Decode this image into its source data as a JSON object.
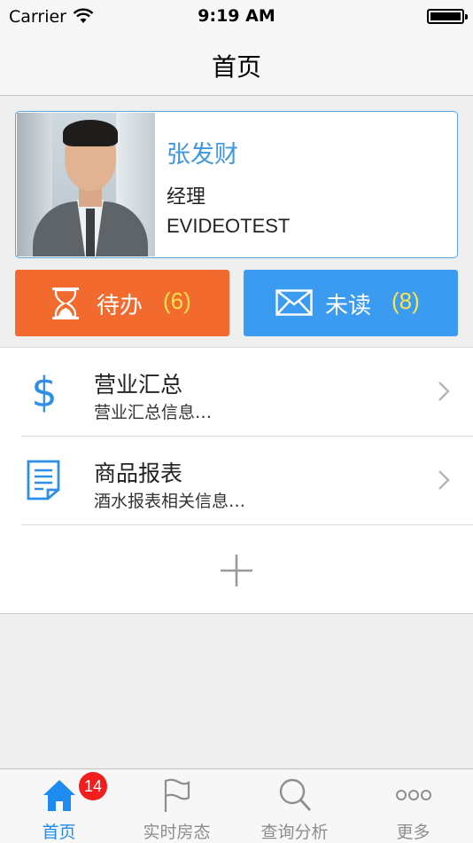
{
  "status_bar": {
    "carrier": "Carrier",
    "time": "9:19 AM"
  },
  "nav": {
    "title": "首页"
  },
  "profile": {
    "name": "张发财",
    "role": "经理",
    "company": "EVIDEOTEST"
  },
  "actions": {
    "todo": {
      "label": "待办",
      "count": "(6)",
      "color": "#f26a2e",
      "icon": "hourglass-icon"
    },
    "unread": {
      "label": "未读",
      "count": "(8)",
      "color": "#3a9bf1",
      "icon": "envelope-icon"
    }
  },
  "list": {
    "items": [
      {
        "title": "营业汇总",
        "subtitle": "营业汇总信息…",
        "icon": "dollar-icon"
      },
      {
        "title": "商品报表",
        "subtitle": "酒水报表相关信息…",
        "icon": "document-icon"
      }
    ],
    "add_icon": "plus-icon"
  },
  "tab_bar": {
    "tabs": [
      {
        "label": "首页",
        "icon": "home-icon",
        "active": true,
        "badge": "14"
      },
      {
        "label": "实时房态",
        "icon": "flag-icon"
      },
      {
        "label": "查询分析",
        "icon": "search-icon"
      },
      {
        "label": "更多",
        "icon": "more-icon"
      }
    ],
    "active_color": "#1e8bf1"
  }
}
